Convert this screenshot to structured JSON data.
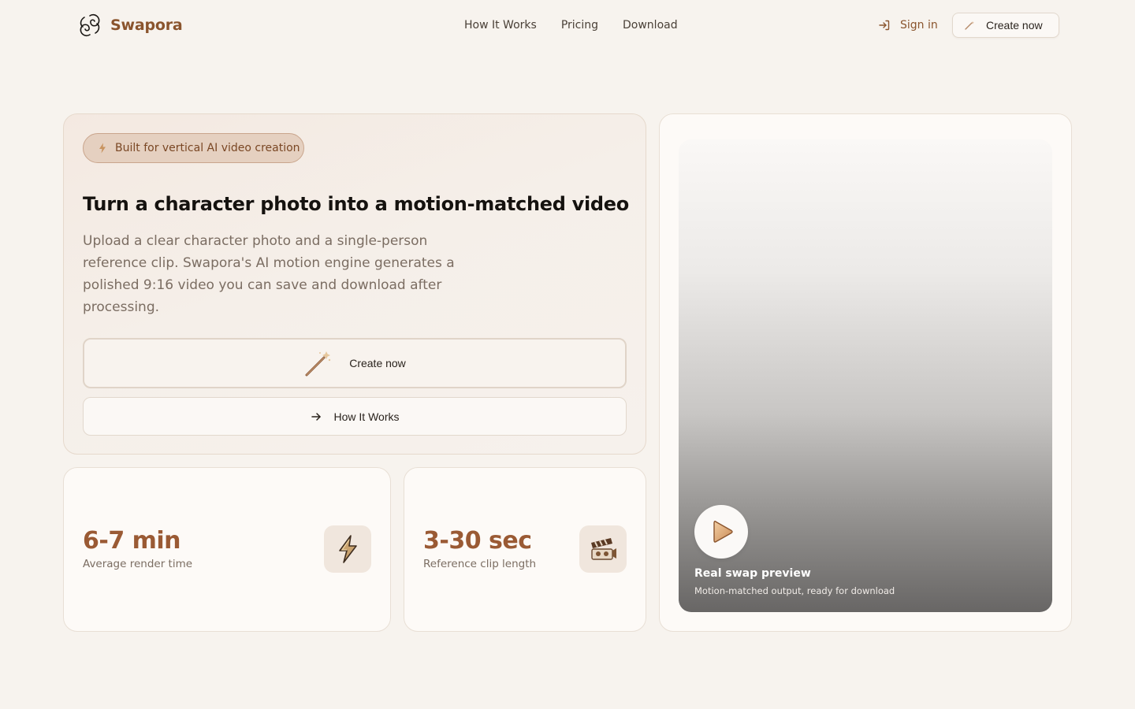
{
  "header": {
    "brand_name": "Swapora",
    "nav": [
      "How It Works",
      "Pricing",
      "Download"
    ],
    "sign_in": "Sign in",
    "create_now": "Create now"
  },
  "hero": {
    "badge": "Built for vertical AI video creation",
    "title": "Turn a character photo into a motion-matched video",
    "description": "Upload a clear character photo and a single-person reference clip. Swapora's AI motion engine generates a polished 9:16 video you can save and download after processing.",
    "primary_button": "Create now",
    "secondary_button": "How It Works"
  },
  "stats": [
    {
      "value": "6-7 min",
      "label": "Average render time",
      "icon": "lightning-icon"
    },
    {
      "value": "3-30 sec",
      "label": "Reference clip length",
      "icon": "film-clapper-icon"
    }
  ],
  "preview": {
    "title": "Real swap preview",
    "subtitle": "Motion-matched output, ready for download",
    "icon": "play-icon"
  },
  "colors": {
    "accent": "#8a542d",
    "stat_value": "#9a5a34",
    "background": "#f7f3ee"
  }
}
